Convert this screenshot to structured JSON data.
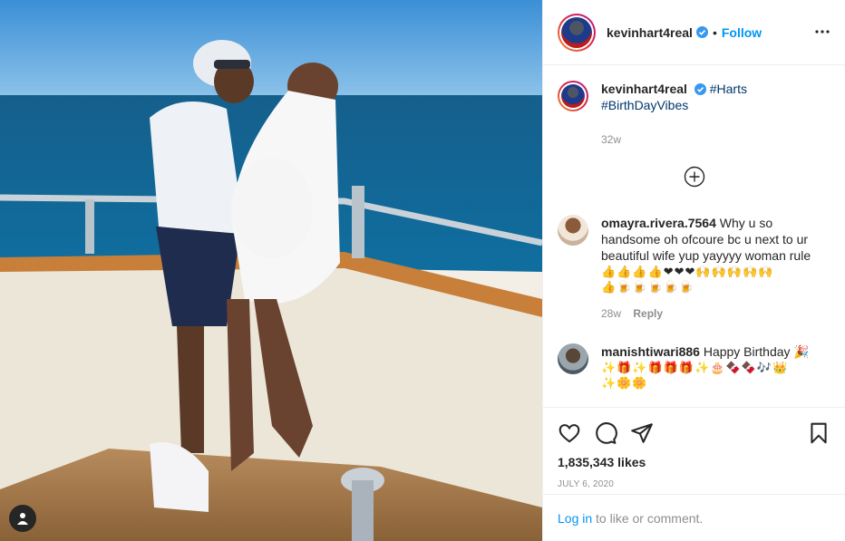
{
  "post": {
    "username": "kevinhart4real",
    "separator": "•",
    "follow_label": "Follow",
    "more_icon": "more-options-icon"
  },
  "caption": {
    "username": "kevinhart4real",
    "hashtag1": "#Harts",
    "hashtag2": "#BirthDayVibes",
    "time": "32w"
  },
  "comments": [
    {
      "username": "omayra.rivera.7564",
      "text": "Why u so handsome oh ofcoure bc u next to ur beautiful wife yup yayyyy woman rule",
      "emoji1": "👍👍👍👍❤❤❤🙌🙌🙌🙌🙌",
      "emoji2": "👍🍺🍺🍺🍺🍺",
      "time": "28w",
      "reply_label": "Reply"
    },
    {
      "username": "manishtiwari886",
      "text": "Happy Birthday 🎉",
      "emoji1": "✨🎁✨🎁🎁🎁✨🎂🍫🍫🎶👑",
      "emoji2": "✨🌼🌼"
    }
  ],
  "stats": {
    "likes": "1,835,343 likes",
    "date": "JULY 6, 2020"
  },
  "login": {
    "link": "Log in",
    "rest": " to like or comment."
  },
  "colors": {
    "accent": "#0095f6",
    "text": "#262626",
    "muted": "#8e8e8e",
    "heart": "#ed4956"
  }
}
